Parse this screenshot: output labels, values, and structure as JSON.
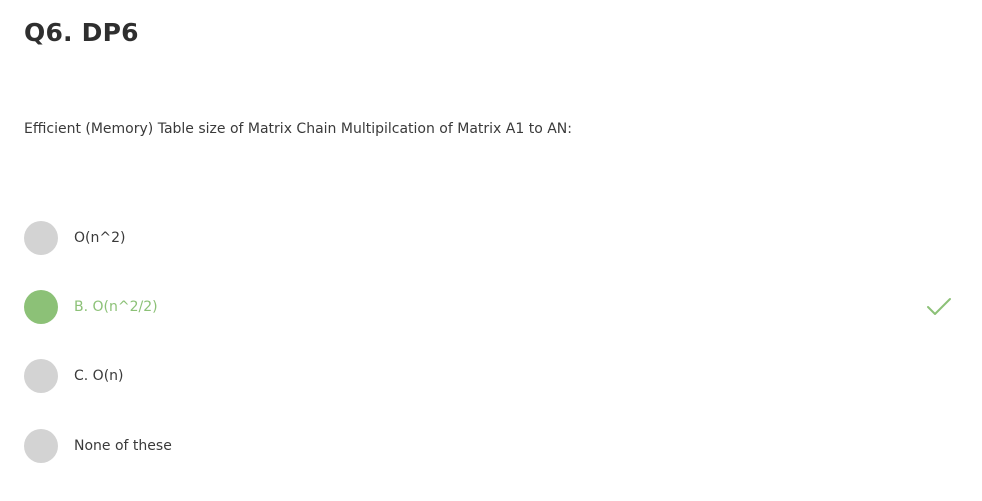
{
  "question": {
    "title": "Q6. DP6",
    "text": "Efficient (Memory) Table size of Matrix Chain Multipilcation of Matrix A1 to AN:"
  },
  "options": [
    {
      "label": "O(n^2)",
      "state": "unselected"
    },
    {
      "label": "B. O(n^2/2)",
      "state": "correct"
    },
    {
      "label": "C. O(n)",
      "state": "unselected"
    },
    {
      "label": "None of these",
      "state": "unselected"
    }
  ],
  "colors": {
    "correct": "#8cc177",
    "radio_default": "#d3d3d3",
    "text": "#3a3a3a"
  },
  "icons": {
    "correct_marker": "check-icon"
  }
}
